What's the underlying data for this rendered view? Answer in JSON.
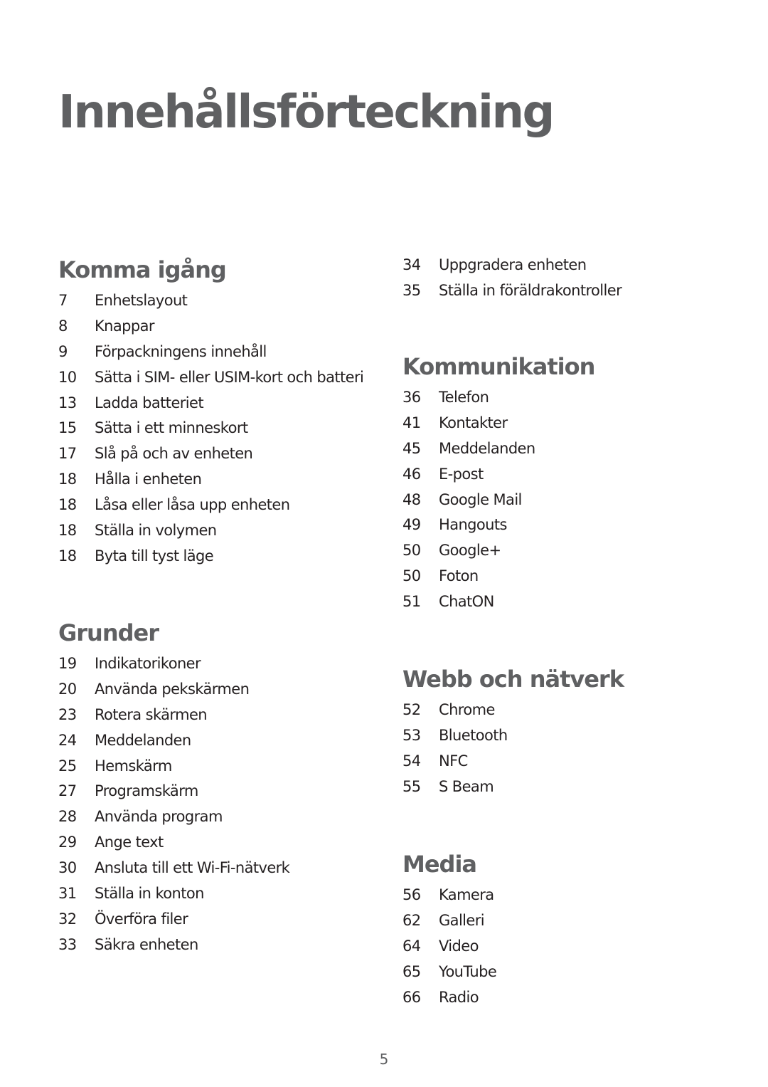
{
  "page_title": "Innehållsförteckning",
  "page_number": "5",
  "sections": {
    "komma_igang": {
      "heading": "Komma igång",
      "items": [
        {
          "page": "7",
          "title": "Enhetslayout"
        },
        {
          "page": "8",
          "title": "Knappar"
        },
        {
          "page": "9",
          "title": "Förpackningens innehåll"
        },
        {
          "page": "10",
          "title": "Sätta i SIM- eller USIM-kort och batteri"
        },
        {
          "page": "13",
          "title": "Ladda batteriet"
        },
        {
          "page": "15",
          "title": "Sätta i ett minneskort"
        },
        {
          "page": "17",
          "title": "Slå på och av enheten"
        },
        {
          "page": "18",
          "title": "Hålla i enheten"
        },
        {
          "page": "18",
          "title": "Låsa eller låsa upp enheten"
        },
        {
          "page": "18",
          "title": "Ställa in volymen"
        },
        {
          "page": "18",
          "title": "Byta till tyst läge"
        }
      ]
    },
    "grunder": {
      "heading": "Grunder",
      "items": [
        {
          "page": "19",
          "title": "Indikatorikoner"
        },
        {
          "page": "20",
          "title": "Använda pekskärmen"
        },
        {
          "page": "23",
          "title": "Rotera skärmen"
        },
        {
          "page": "24",
          "title": "Meddelanden"
        },
        {
          "page": "25",
          "title": "Hemskärm"
        },
        {
          "page": "27",
          "title": "Programskärm"
        },
        {
          "page": "28",
          "title": "Använda program"
        },
        {
          "page": "29",
          "title": "Ange text"
        },
        {
          "page": "30",
          "title": "Ansluta till ett Wi-Fi-nätverk"
        },
        {
          "page": "31",
          "title": "Ställa in konton"
        },
        {
          "page": "32",
          "title": "Överföra filer"
        },
        {
          "page": "33",
          "title": "Säkra enheten"
        }
      ]
    },
    "grunder_cont": {
      "items": [
        {
          "page": "34",
          "title": "Uppgradera enheten"
        },
        {
          "page": "35",
          "title": "Ställa in föräldrakontroller"
        }
      ]
    },
    "kommunikation": {
      "heading": "Kommunikation",
      "items": [
        {
          "page": "36",
          "title": "Telefon"
        },
        {
          "page": "41",
          "title": "Kontakter"
        },
        {
          "page": "45",
          "title": "Meddelanden"
        },
        {
          "page": "46",
          "title": "E-post"
        },
        {
          "page": "48",
          "title": "Google Mail"
        },
        {
          "page": "49",
          "title": "Hangouts"
        },
        {
          "page": "50",
          "title": "Google+"
        },
        {
          "page": "50",
          "title": "Foton"
        },
        {
          "page": "51",
          "title": "ChatON"
        }
      ]
    },
    "webb": {
      "heading": "Webb och nätverk",
      "items": [
        {
          "page": "52",
          "title": "Chrome"
        },
        {
          "page": "53",
          "title": "Bluetooth"
        },
        {
          "page": "54",
          "title": "NFC"
        },
        {
          "page": "55",
          "title": "S Beam"
        }
      ]
    },
    "media": {
      "heading": "Media",
      "items": [
        {
          "page": "56",
          "title": "Kamera"
        },
        {
          "page": "62",
          "title": "Galleri"
        },
        {
          "page": "64",
          "title": "Video"
        },
        {
          "page": "65",
          "title": "YouTube"
        },
        {
          "page": "66",
          "title": "Radio"
        }
      ]
    }
  },
  "colors": {
    "heading": "#5f6062",
    "body_text": "#231f20",
    "background": "#ffffff"
  }
}
